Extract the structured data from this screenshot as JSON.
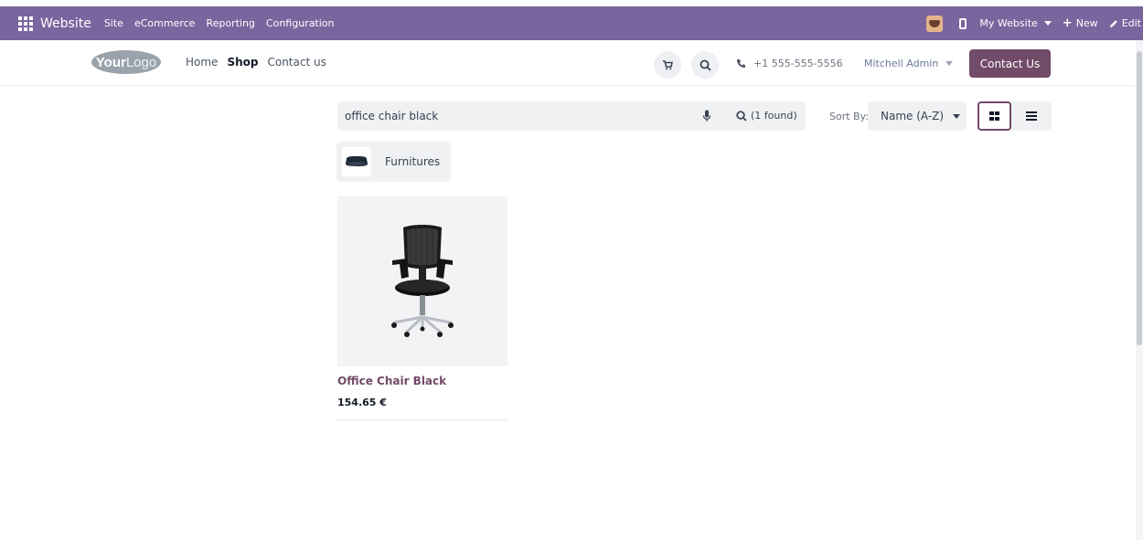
{
  "admin_bar": {
    "brand": "Website",
    "menu": [
      "Site",
      "eCommerce",
      "Reporting",
      "Configuration"
    ],
    "website_switcher": "My Website",
    "new_label": "New",
    "edit_label": "Edit"
  },
  "header": {
    "logo_bold": "Your",
    "logo_light": "Logo",
    "nav": [
      "Home",
      "Shop",
      "Contact us"
    ],
    "phone": "+1 555-555-5556",
    "user": "Mitchell Admin",
    "contact_button": "Contact Us"
  },
  "search": {
    "query": "office chair black",
    "result_count": "(1 found)"
  },
  "sort": {
    "label": "Sort By:",
    "selected": "Name (A-Z)"
  },
  "category": {
    "label": "Furnitures"
  },
  "products": [
    {
      "name": "Office Chair Black",
      "price": "154.65 €"
    }
  ],
  "colors": {
    "admin_bar": "#7a659e",
    "brand_primary": "#714b67"
  }
}
